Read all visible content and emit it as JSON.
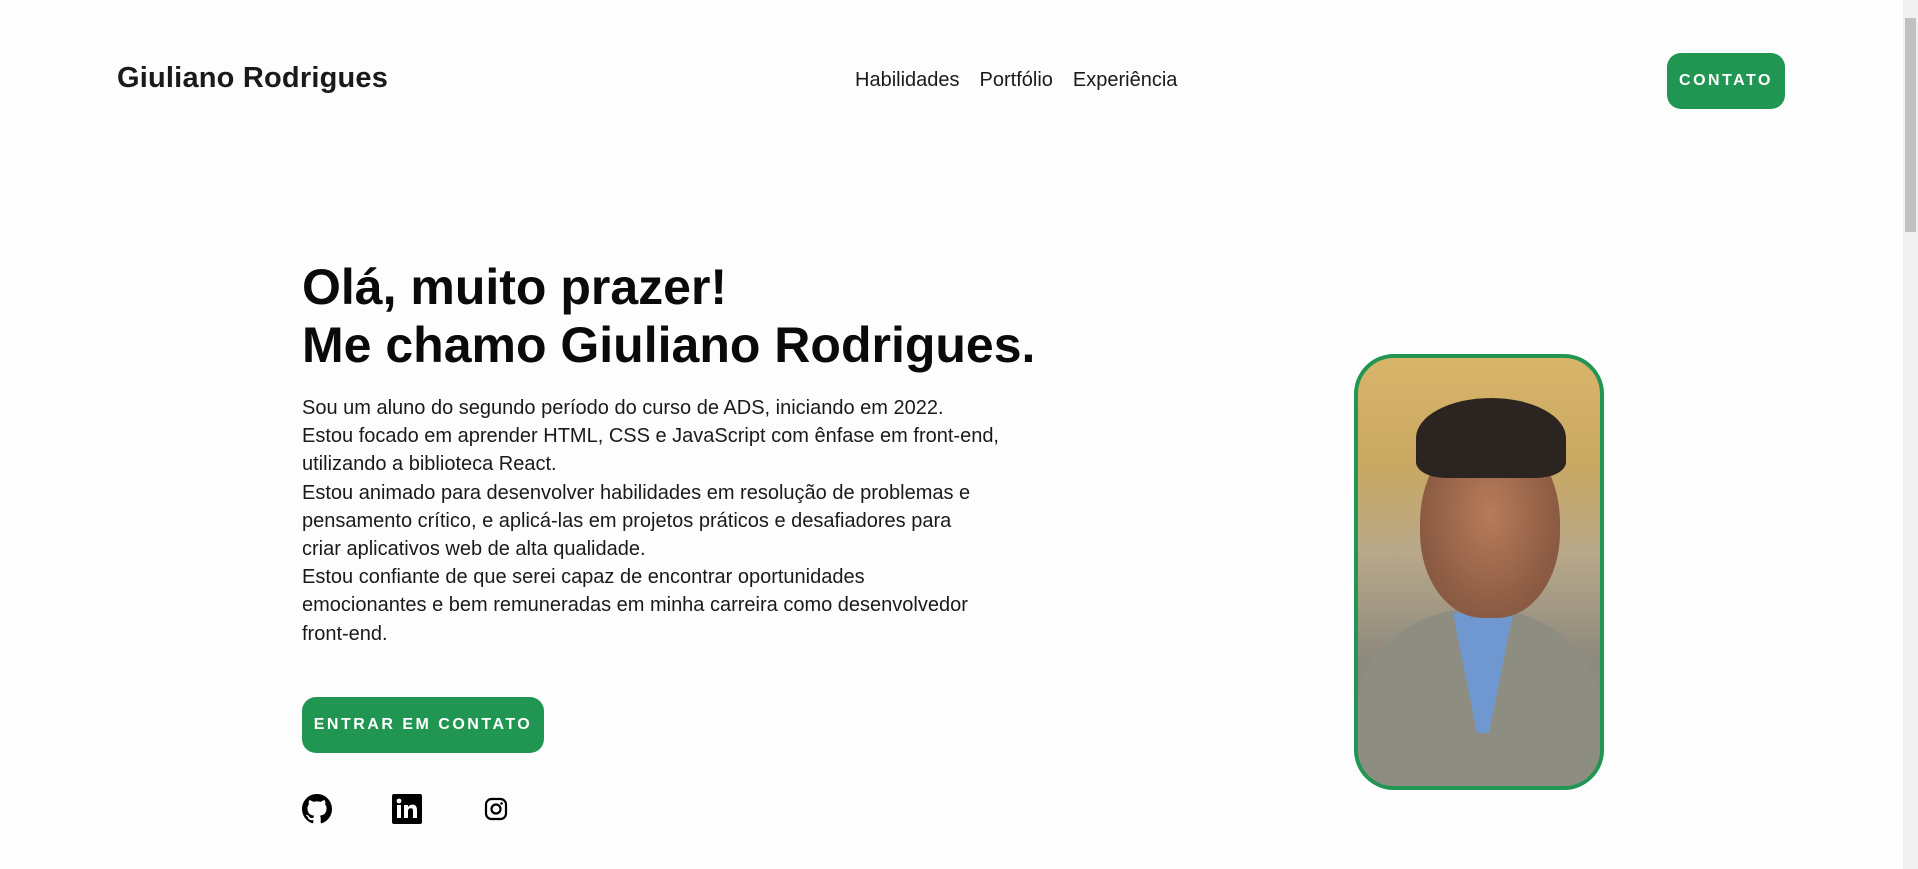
{
  "header": {
    "logo": "Giuliano Rodrigues",
    "nav": [
      "Habilidades",
      "Portfólio",
      "Experiência"
    ],
    "contact_button": "CONTATO"
  },
  "hero": {
    "title_line1": "Olá, muito prazer!",
    "title_line2": "Me chamo Giuliano Rodrigues.",
    "paragraph_lines": [
      "Sou um aluno do segundo período do curso de ADS, iniciando em 2022.",
      "Estou focado em aprender HTML, CSS e JavaScript com ênfase em front-end,",
      "utilizando a biblioteca React.",
      "Estou animado para desenvolver habilidades em resolução de problemas e",
      "pensamento crítico, e aplicá-las em projetos práticos e desafiadores para",
      "criar aplicativos web de alta qualidade.",
      "Estou confiante de que serei capaz de encontrar oportunidades",
      "emocionantes e bem remuneradas em minha carreira como desenvolvedor",
      "front-end."
    ],
    "cta_button": "ENTRAR EM CONTATO",
    "socials": [
      "github-icon",
      "linkedin-icon",
      "instagram-icon"
    ]
  },
  "colors": {
    "accent": "#219653",
    "text": "#111111",
    "background": "#fdfdfd"
  }
}
